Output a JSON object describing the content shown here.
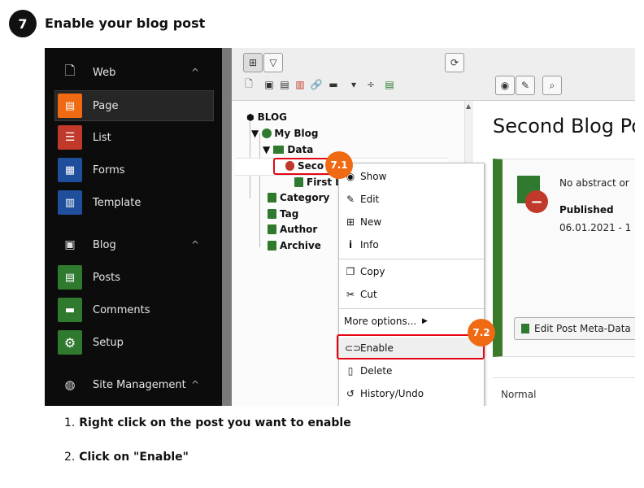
{
  "heading": {
    "number": "7",
    "title": "Enable your blog post"
  },
  "sidebar": {
    "items": [
      {
        "label": "Web",
        "icon": "page-outline-icon",
        "chevron": "^",
        "icon_color": "",
        "section": true
      },
      {
        "label": "Page",
        "icon": "page-module-icon",
        "icon_color": "#f06a14",
        "active": true
      },
      {
        "label": "List",
        "icon": "list-module-icon",
        "icon_color": "#c0392b"
      },
      {
        "label": "Forms",
        "icon": "forms-module-icon",
        "icon_color": "#1f4f9c"
      },
      {
        "label": "Template",
        "icon": "template-module-icon",
        "icon_color": "#1f4f9c"
      },
      {
        "label": "Blog",
        "icon": "blog-outline-icon",
        "chevron": "^",
        "section": true
      },
      {
        "label": "Posts",
        "icon": "posts-module-icon",
        "icon_color": "#2f7a2f"
      },
      {
        "label": "Comments",
        "icon": "comments-module-icon",
        "icon_color": "#2f7a2f"
      },
      {
        "label": "Setup",
        "icon": "gear-icon",
        "icon_color": "#2f7a2f"
      },
      {
        "label": "Site Management",
        "icon": "globe-icon",
        "chevron": "^",
        "section": true
      }
    ]
  },
  "tree": {
    "root": "BLOG",
    "site": "My Blog",
    "folder": "Data",
    "post_selected": "Seco",
    "post_2": "First bl",
    "items": [
      "Category",
      "Tag",
      "Author",
      "Archive"
    ]
  },
  "context_menu": {
    "show": "Show",
    "edit": "Edit",
    "new": "New",
    "info": "Info",
    "copy": "Copy",
    "cut": "Cut",
    "more": "More options...",
    "enable": "Enable",
    "delete": "Delete",
    "history": "History/Undo"
  },
  "content": {
    "title": "Second Blog Pos",
    "abstract": "No abstract or",
    "status": "Published",
    "date": "06.01.2021 - 1",
    "edit_button": "Edit Post Meta-Data",
    "section_label": "Normal"
  },
  "badges": {
    "b1": "7.1",
    "b2": "7.2"
  },
  "steps": [
    {
      "num": "1.",
      "text": "Right click on the post you want to enable"
    },
    {
      "num": "2.",
      "text": "Click on \"Enable\""
    }
  ],
  "colors": {
    "accent": "#f06a14",
    "highlight": "#e30613",
    "blog_green": "#2f7a2f"
  }
}
